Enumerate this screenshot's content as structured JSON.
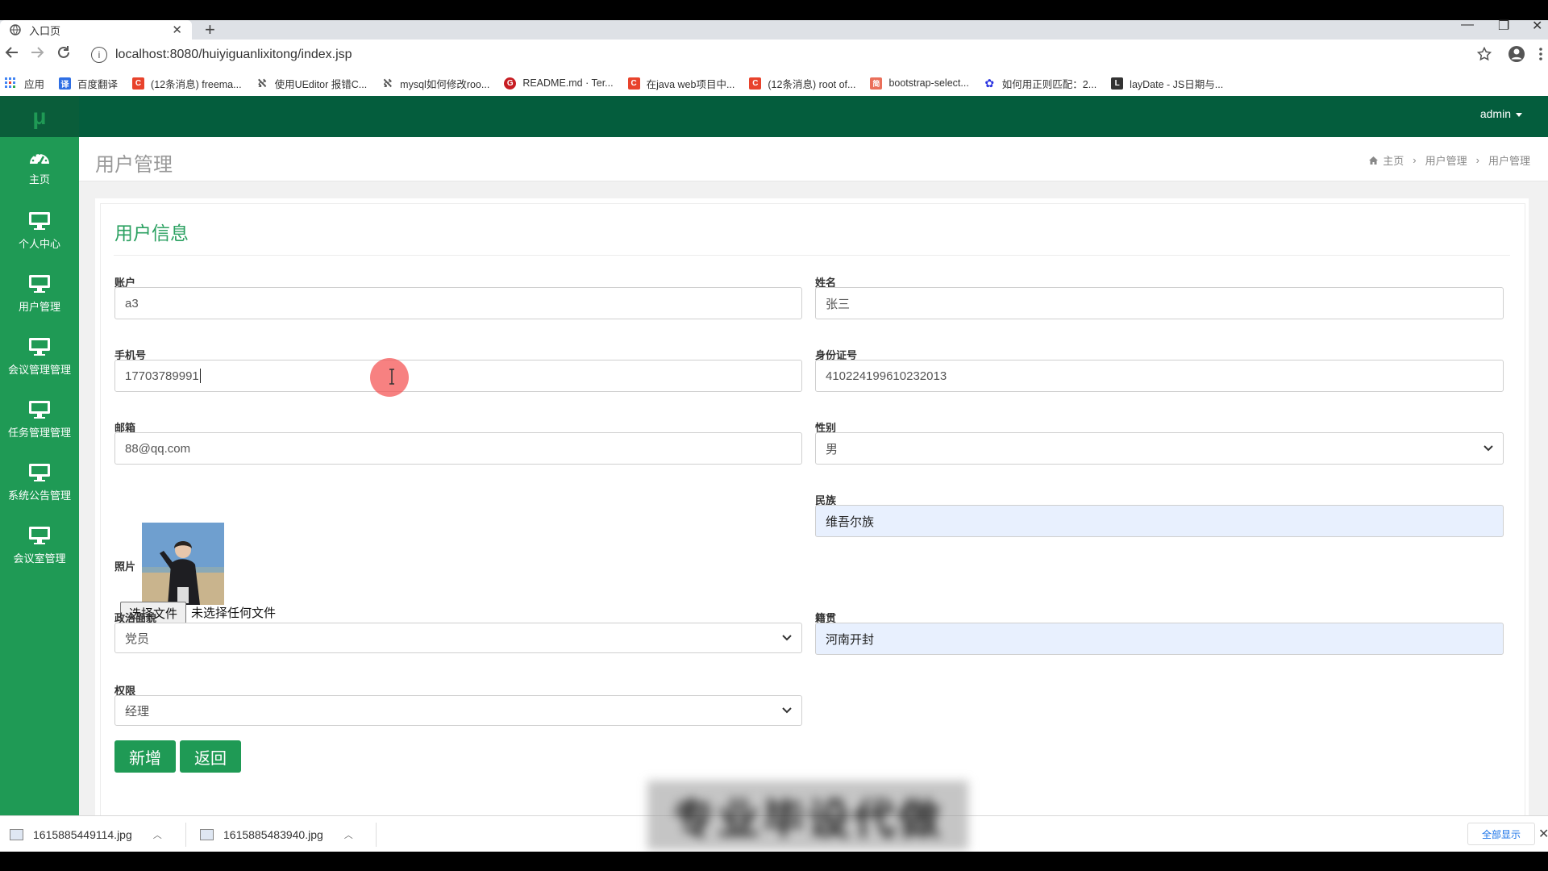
{
  "browser": {
    "tab_title": "入口页",
    "tab_close": "✕",
    "new_tab": "+",
    "url": "localhost:8080/huiyiguanlixitong/index.jsp",
    "win_min": "—",
    "win_restore": "❐",
    "win_close": "✕",
    "bookmarks": [
      {
        "label": "应用",
        "icon": "apps-grid-icon",
        "color": "#4285f4"
      },
      {
        "label": "百度翻译",
        "icon": "baidu-translate-icon",
        "color": "#2f6fe4",
        "glyph": "译"
      },
      {
        "label": "(12条消息) freema...",
        "icon": "csdn-icon",
        "color": "#e8432c",
        "glyph": "C"
      },
      {
        "label": "使用UEditor 报错C...",
        "icon": "ueditor-icon",
        "color": "#555555",
        "glyph": "ℵ"
      },
      {
        "label": "mysql如何修改roo...",
        "icon": "ueditor-icon",
        "color": "#555555",
        "glyph": "ℵ"
      },
      {
        "label": "README.md · Ter...",
        "icon": "gitee-icon",
        "color": "#c71d23",
        "glyph": "G"
      },
      {
        "label": "在java web项目中...",
        "icon": "csdn-icon",
        "color": "#e8432c",
        "glyph": "C"
      },
      {
        "label": "(12条消息) root of...",
        "icon": "csdn-icon",
        "color": "#e8432c",
        "glyph": "C"
      },
      {
        "label": "bootstrap-select...",
        "icon": "jianshu-icon",
        "color": "#ea6f5a",
        "glyph": "简"
      },
      {
        "label": "如何用正则匹配：2...",
        "icon": "baidu-paw-icon",
        "color": "#2932e1",
        "glyph": "✿"
      },
      {
        "label": "layDate - JS日期与...",
        "icon": "layui-icon",
        "color": "#333333",
        "glyph": "L"
      }
    ]
  },
  "sidebar": {
    "logo": "μ",
    "items": [
      {
        "label": "主页",
        "icon": "dashboard-icon"
      },
      {
        "label": "个人中心",
        "icon": "monitor-icon"
      },
      {
        "label": "用户管理",
        "icon": "monitor-icon"
      },
      {
        "label": "会议管理管理",
        "icon": "monitor-icon"
      },
      {
        "label": "任务管理管理",
        "icon": "monitor-icon"
      },
      {
        "label": "系统公告管理",
        "icon": "monitor-icon"
      },
      {
        "label": "会议室管理",
        "icon": "monitor-icon"
      }
    ]
  },
  "topbar": {
    "user": "admin"
  },
  "header": {
    "title": "用户管理",
    "breadcrumb": [
      "主页",
      "用户管理",
      "用户管理"
    ],
    "breadcrumb_sep": "›"
  },
  "form": {
    "title": "用户信息",
    "account": {
      "label": "账户",
      "value": "a3"
    },
    "name": {
      "label": "姓名",
      "value": "张三"
    },
    "phone": {
      "label": "手机号",
      "value": "17703789991"
    },
    "idcard": {
      "label": "身份证号",
      "value": "410224199610232013"
    },
    "email": {
      "label": "邮箱",
      "value": "88@qq.com"
    },
    "gender": {
      "label": "性别",
      "value": "男"
    },
    "photo": {
      "label": "照片",
      "choose_button": "选择文件",
      "no_file": "未选择任何文件"
    },
    "ethnicity": {
      "label": "民族",
      "value": "维吾尔族"
    },
    "political": {
      "label": "政治面貌",
      "value": "党员"
    },
    "native_place": {
      "label": "籍贯",
      "value": "河南开封"
    },
    "role": {
      "label": "权限",
      "value": "经理"
    },
    "add_button": "新增",
    "back_button": "返回"
  },
  "downloads": {
    "files": [
      "1615885449114.jpg",
      "1615885483940.jpg"
    ],
    "show_all": "全部显示",
    "close": "✕"
  },
  "watermark": "专业毕设代做",
  "colors": {
    "sidebar": "#1f9a55",
    "topbar": "#045d3d",
    "accent": "#2ba161",
    "autofill": "#e8f0fe"
  }
}
